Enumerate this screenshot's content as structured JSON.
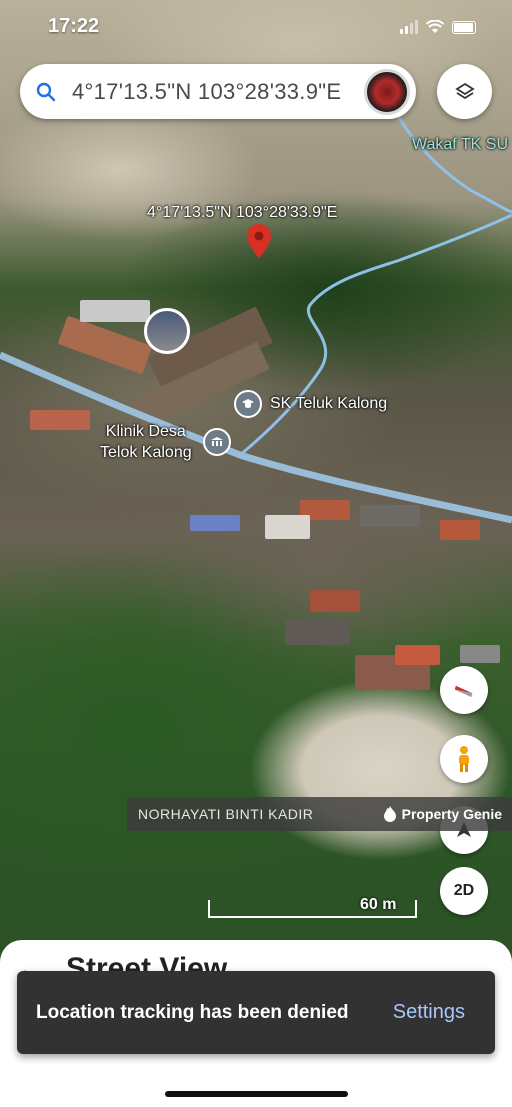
{
  "status_bar": {
    "time": "17:22"
  },
  "search": {
    "query": "4°17'13.5\"N 103°28'33.9\"E"
  },
  "map": {
    "pin_coordinates": "4°17'13.5\"N 103°28'33.9\"E",
    "labels": {
      "school": "SK Teluk Kalong",
      "clinic": "Klinik Desa\nTelok Kalong",
      "wakaf": "Wakaf TK SU"
    },
    "scale": "60 m"
  },
  "photo_credit": {
    "author": "NORHAYATI BINTI KADIR",
    "brand": "Property Genie"
  },
  "controls": {
    "view_mode": "2D"
  },
  "sheet": {
    "title": "Street View"
  },
  "snackbar": {
    "message": "Location tracking has been denied",
    "action": "Settings"
  },
  "colors": {
    "road": "#9fc7e6",
    "pin": "#d93025",
    "accent_link": "#a8c7fa"
  }
}
